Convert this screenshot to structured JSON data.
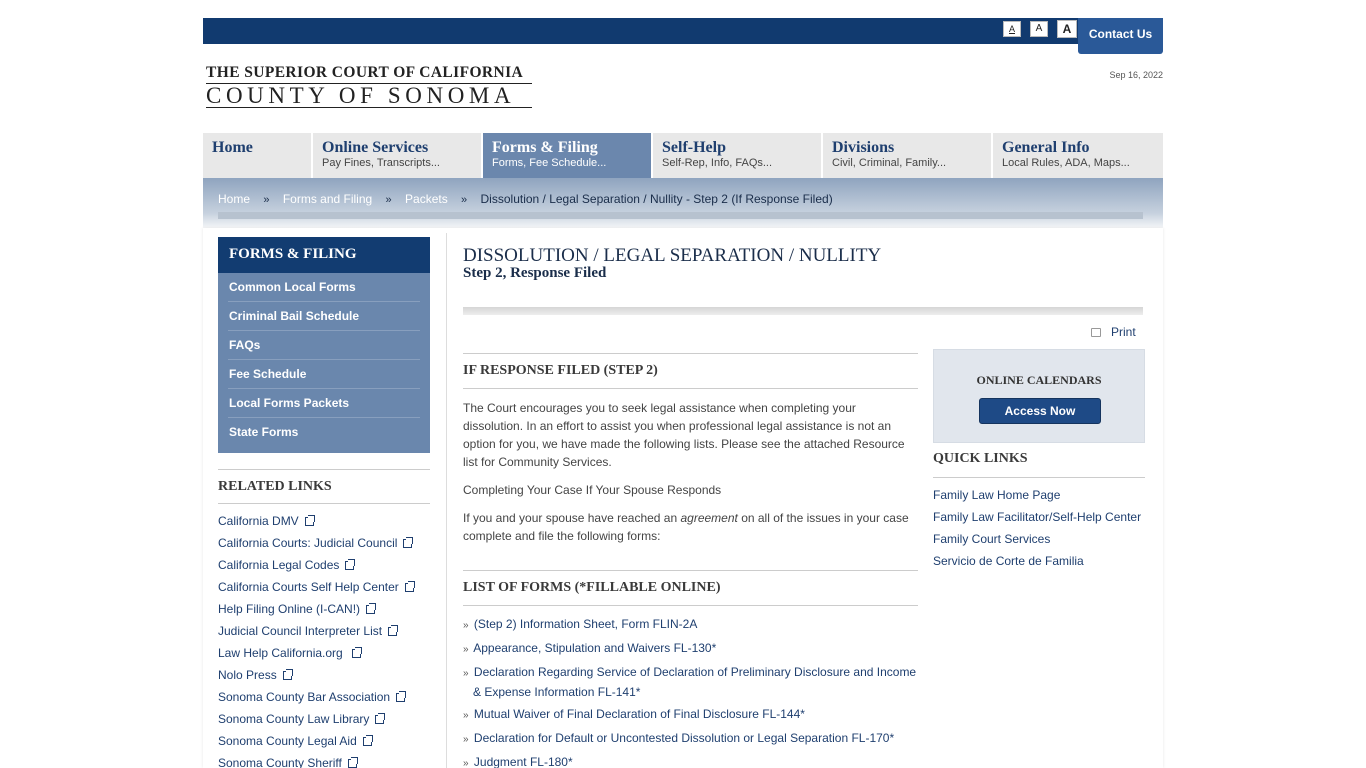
{
  "topbar": {
    "font_small": "A",
    "font_medium": "A",
    "font_large": "A",
    "contact": "Contact Us"
  },
  "header": {
    "logo_line1": "THE SUPERIOR COURT OF CALIFORNIA",
    "logo_line2": "COUNTY OF SONOMA",
    "date": "Sep 16, 2022"
  },
  "nav": [
    {
      "title": "Home",
      "sub": ""
    },
    {
      "title": "Online Services",
      "sub": "Pay Fines, Transcripts..."
    },
    {
      "title": "Forms & Filing",
      "sub": "Forms, Fee Schedule..."
    },
    {
      "title": "Self-Help",
      "sub": "Self-Rep, Info, FAQs..."
    },
    {
      "title": "Divisions",
      "sub": "Civil, Criminal, Family..."
    },
    {
      "title": "General Info",
      "sub": "Local Rules, ADA, Maps..."
    }
  ],
  "breadcrumb": {
    "items": [
      "Home",
      "Forms and Filing",
      "Packets"
    ],
    "separator": "»",
    "current": "Dissolution / Legal Separation / Nullity - Step 2 (If Response Filed)"
  },
  "left_menu": {
    "title": "FORMS & FILING",
    "items": [
      "Common Local Forms",
      "Criminal Bail Schedule",
      "FAQs",
      "Fee Schedule",
      "Local Forms Packets",
      "State Forms"
    ]
  },
  "related_links": {
    "title": "RELATED LINKS",
    "items": [
      "California DMV",
      "California Courts: Judicial Council",
      "California Legal Codes",
      "California Courts Self Help Center",
      "Help Filing Online (I-CAN!)",
      "Judicial Council Interpreter List",
      "Law Help California.org",
      "Nolo Press",
      "Sonoma County Bar Association",
      "Sonoma County Law Library",
      "Sonoma County Legal Aid",
      "Sonoma County Sheriff"
    ]
  },
  "main": {
    "title": "DISSOLUTION / LEGAL SEPARATION / NULLITY",
    "subtitle": "Step 2, Response Filed",
    "print": "Print",
    "section1_title": "IF RESPONSE FILED (STEP 2)",
    "para1": "The Court encourages you to seek legal assistance when completing your dissolution.  In an effort to assist you when professional legal assistance is not an option for you, we have made the following lists. Please see the attached Resource list for Community Services.",
    "para2": "Completing Your Case If Your Spouse Responds",
    "para3_before": "If you and your spouse have reached an ",
    "para3_em": "agreement",
    "para3_after": " on all of the issues in your case complete and file the following forms:",
    "forms_title": "LIST OF FORMS (*FILLABLE ONLINE)",
    "bullet": "»",
    "forms": [
      "(Step 2) Information Sheet, Form FLIN-2A",
      "Appearance, Stipulation and Waivers FL-130*",
      "Declaration Regarding Service of Declaration of Preliminary Disclosure and Income & Expense Information FL-141*",
      "Mutual Waiver of Final Declaration of Final Disclosure FL-144*",
      "Declaration for Default or Uncontested Dissolution or Legal Separation FL-170*",
      "Judgment FL-180*"
    ]
  },
  "right": {
    "calendars_title": "ONLINE CALENDARS",
    "access_button": "Access Now",
    "quick_title": "QUICK LINKS",
    "quick_links": [
      "Family Law Home Page",
      "Family Law Facilitator/Self-Help Center",
      "Family Court Services",
      "Servicio de Corte de Familia"
    ]
  },
  "colors": {
    "brand_navy": "#113a6f",
    "nav_active": "#6b87ad",
    "link": "#1f3f6f"
  }
}
